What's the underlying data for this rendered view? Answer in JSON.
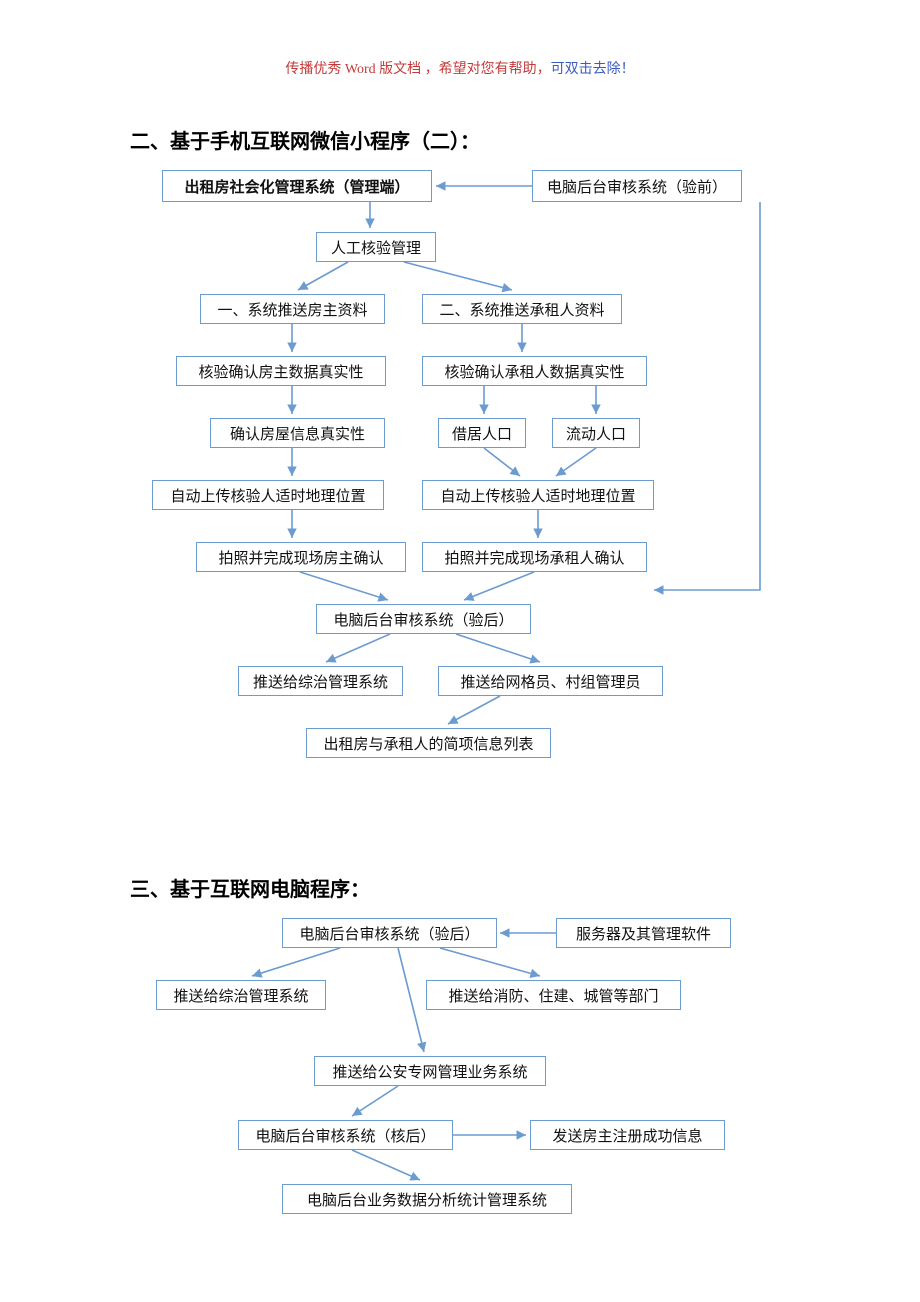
{
  "watermark": {
    "part1": "传播优秀 Word 版文档 ，希望对您有帮助，",
    "part2": "可双击去除！"
  },
  "heading1": "二、基于手机互联网微信小程序（二）：",
  "heading2": "三、基于互联网电脑程序：",
  "d1": {
    "n1": "出租房社会化管理系统（管理端）",
    "n2": "电脑后台审核系统（验前）",
    "n3": "人工核验管理",
    "n4": "一、系统推送房主资料",
    "n5": "二、系统推送承租人资料",
    "n6": "核验确认房主数据真实性",
    "n7": "核验确认承租人数据真实性",
    "n8": "确认房屋信息真实性",
    "n9": "借居人口",
    "n10": "流动人口",
    "n11": "自动上传核验人适时地理位置",
    "n12": "自动上传核验人适时地理位置",
    "n13": "拍照并完成现场房主确认",
    "n14": "拍照并完成现场承租人确认",
    "n15": "电脑后台审核系统（验后）",
    "n16": "推送给综治管理系统",
    "n17": "推送给网格员、村组管理员",
    "n18": "出租房与承租人的简项信息列表"
  },
  "d2": {
    "n1": "电脑后台审核系统（验后）",
    "n2": "服务器及其管理软件",
    "n3": "推送给综治管理系统",
    "n4": "推送给消防、住建、城管等部门",
    "n5": "推送给公安专网管理业务系统",
    "n6": "电脑后台审核系统（核后）",
    "n7": "发送房主注册成功信息",
    "n8": "电脑后台业务数据分析统计管理系统"
  },
  "colors": {
    "arrow": "#6b9bd1"
  }
}
